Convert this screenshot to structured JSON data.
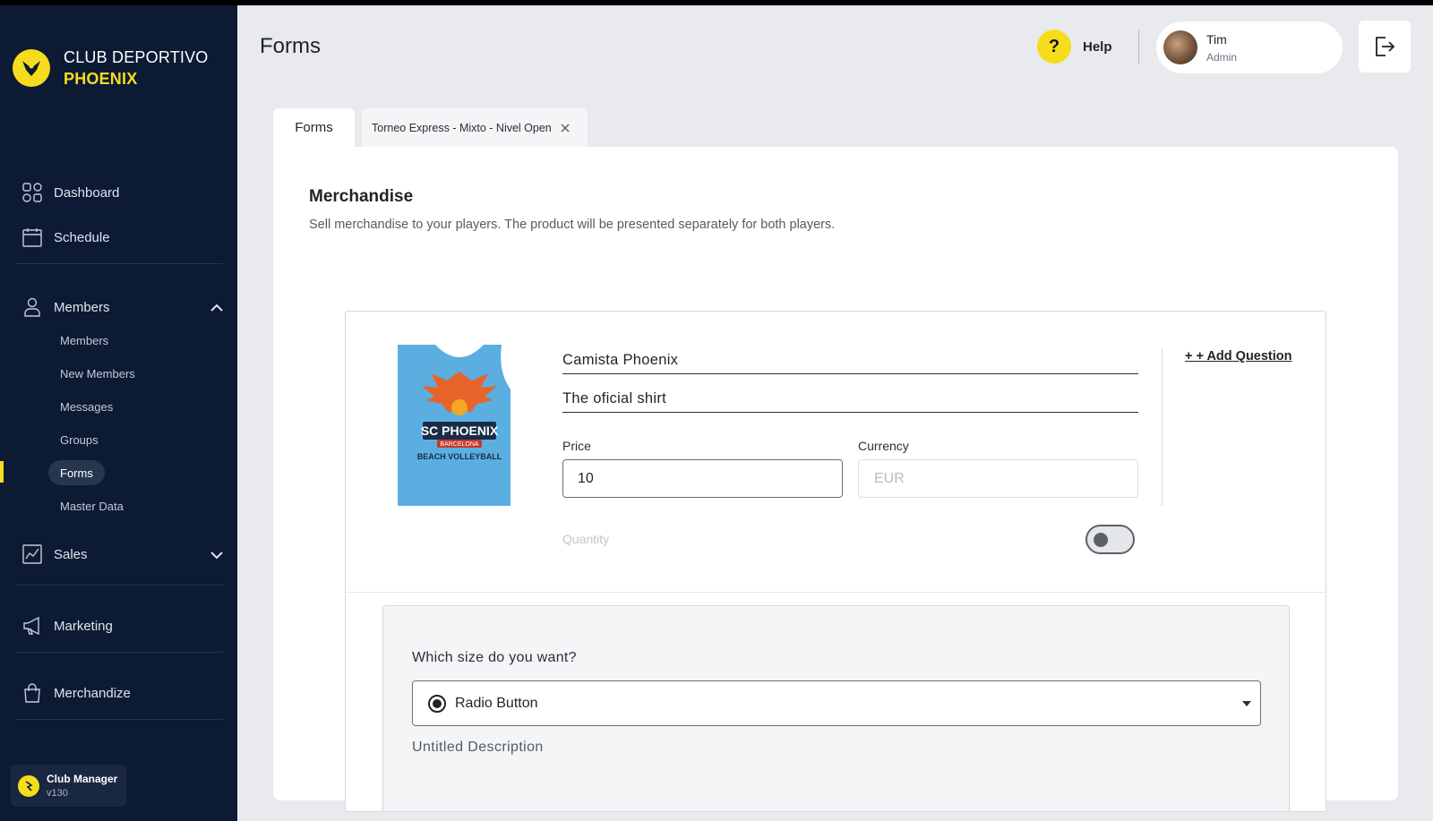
{
  "brand": {
    "line1": "CLUB DEPORTIVO",
    "line2": "PHOENIX"
  },
  "nav": {
    "dashboard": "Dashboard",
    "schedule": "Schedule",
    "members": "Members",
    "members_sub": [
      "Members",
      "New Members",
      "Messages",
      "Groups",
      "Forms",
      "Master Data"
    ],
    "sales": "Sales",
    "marketing": "Marketing",
    "merchandize": "Merchandize"
  },
  "app": {
    "name": "Club Manager",
    "version": "v130"
  },
  "header": {
    "title": "Forms",
    "help": "Help",
    "user_name": "Tim",
    "user_role": "Admin"
  },
  "tabs": {
    "forms": "Forms",
    "active": "Torneo Express - Mixto - Nivel Open"
  },
  "section": {
    "title": "Merchandise",
    "description": "Sell merchandise to your players. The product will be presented separately for both players."
  },
  "product": {
    "name": "Camista Phoenix",
    "description": "The oficial shirt",
    "price_label": "Price",
    "price_value": "10",
    "currency_label": "Currency",
    "currency_placeholder": "EUR",
    "quantity_label": "Quantity",
    "quantity_enabled": false,
    "add_question": "+ + Add Question",
    "shirt_text1": "SC PHOENIX",
    "shirt_text2": "BARCELONA",
    "shirt_text3": "BEACH VOLLEYBALL"
  },
  "question": {
    "title": "Which size do you want?",
    "type": "Radio Button",
    "description": "Untitled Description"
  },
  "colors": {
    "sidebar": "#0c1a33",
    "accent": "#f5dc1c",
    "background": "#e9eaed"
  }
}
